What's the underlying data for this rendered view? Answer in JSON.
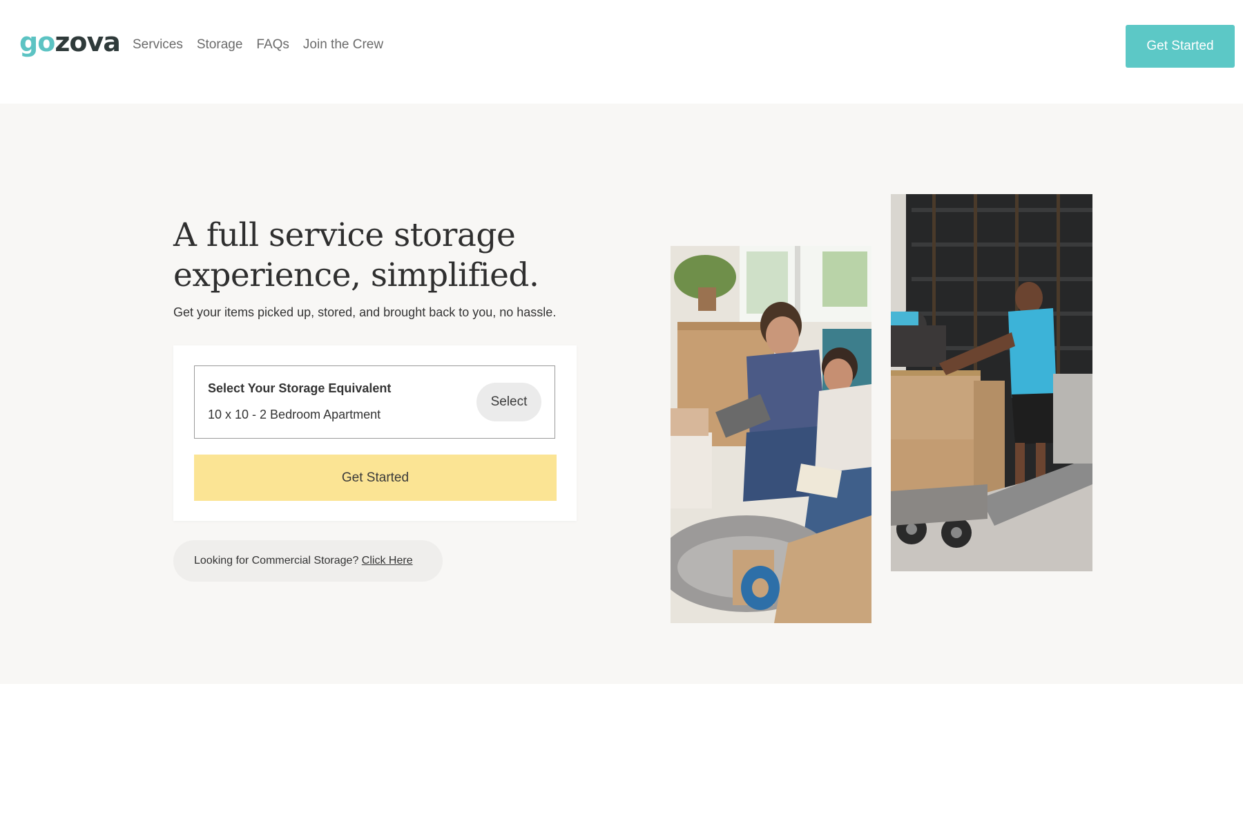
{
  "brand": {
    "logo_part1": "go",
    "logo_part2": "zova",
    "accent": "#5cc8c6",
    "dark": "#2f3a3a"
  },
  "nav": {
    "items": [
      {
        "label": "Services"
      },
      {
        "label": "Storage"
      },
      {
        "label": "FAQs"
      },
      {
        "label": "Join the Crew"
      }
    ],
    "cta_label": "Get Started"
  },
  "hero": {
    "headline": "A full service storage experience, simplified.",
    "subhead": "Get your items picked up, stored, and brought back to you, no hassle.",
    "selector": {
      "label": "Select Your Storage Equivalent",
      "value": "10 x 10 - 2 Bedroom Apartment",
      "button_label": "Select"
    },
    "primary_button_label": "Get Started",
    "primary_button_color": "#fbe494",
    "commercial": {
      "text": "Looking for Commercial Storage?",
      "link_label": "Click Here"
    }
  }
}
